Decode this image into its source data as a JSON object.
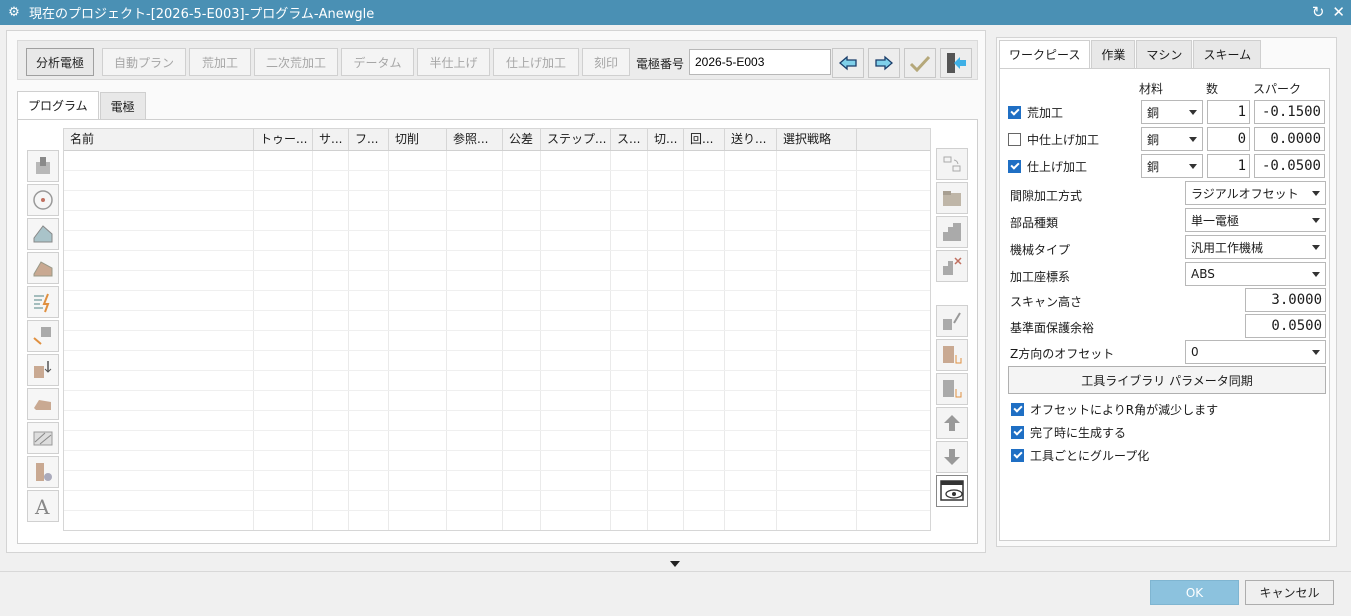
{
  "window": {
    "title": "現在のプロジェクト-[2026-5-E003]-プログラム-Anewgle"
  },
  "toolbar": {
    "buttons": [
      {
        "label": "分析電極",
        "active": true
      },
      {
        "label": "自動プラン",
        "active": false
      },
      {
        "label": "荒加工",
        "active": false
      },
      {
        "label": "二次荒加工",
        "active": false
      },
      {
        "label": "データム",
        "active": false
      },
      {
        "label": "半仕上げ",
        "active": false
      },
      {
        "label": "仕上げ加工",
        "active": false
      },
      {
        "label": "刻印",
        "active": false
      }
    ],
    "electrode_label": "電極番号",
    "electrode_value": "2026-5-E003",
    "icons": [
      "arrow-left-icon",
      "arrow-right-icon",
      "checkmark-icon",
      "exit-icon"
    ]
  },
  "left_tabs": [
    "プログラム",
    "電極"
  ],
  "grid": {
    "columns": [
      "名前",
      "トゥー...",
      "サ...",
      "フ...",
      "切削",
      "参照...",
      "公差",
      "ステップ...",
      "ス...",
      "切...",
      "回...",
      "送り...",
      "選択戦略"
    ],
    "rows": 19
  },
  "side_tools": [
    "cavity-icon",
    "target-icon",
    "surface-icon",
    "block-icon",
    "path-icon",
    "move-icon",
    "split-icon",
    "solid-icon",
    "hatch-icon",
    "tool-icon",
    "text-icon"
  ],
  "right_tools": [
    "sync-icon",
    "folder-icon",
    "stair-icon",
    "delete-icon",
    "edit-icon",
    "pick-icon",
    "pick2-icon",
    "up-icon",
    "down-icon",
    "view-icon"
  ],
  "right_tabs": [
    "ワークピース",
    "作業",
    "マシン",
    "スキーム"
  ],
  "workpiece": {
    "headers": {
      "material": "材料",
      "count": "数",
      "spark": "スパーク"
    },
    "stages": [
      {
        "label": "荒加工",
        "checked": true,
        "material": "銅",
        "count": "1",
        "spark": "-0.1500"
      },
      {
        "label": "中仕上げ加工",
        "checked": false,
        "material": "銅",
        "count": "0",
        "spark": "0.0000"
      },
      {
        "label": "仕上げ加工",
        "checked": true,
        "material": "銅",
        "count": "1",
        "spark": "-0.0500"
      }
    ],
    "params": [
      {
        "label": "間隙加工方式",
        "value": "ラジアルオフセット",
        "type": "select"
      },
      {
        "label": "部品種類",
        "value": "単一電極",
        "type": "select"
      },
      {
        "label": "機械タイプ",
        "value": "汎用工作機械",
        "type": "select"
      },
      {
        "label": "加工座標系",
        "value": "ABS",
        "type": "select"
      },
      {
        "label": "スキャン高さ",
        "value": "3.0000",
        "type": "number"
      },
      {
        "label": "基準面保護余裕",
        "value": "0.0500",
        "type": "number"
      },
      {
        "label": "Z方向のオフセット",
        "value": "0",
        "type": "select"
      }
    ],
    "sync_button": "工具ライブラリ パラメータ同期",
    "options": [
      {
        "label": "オフセットによりR角が減少します",
        "checked": true
      },
      {
        "label": "完了時に生成する",
        "checked": true
      },
      {
        "label": "工具ごとにグループ化",
        "checked": true
      }
    ]
  },
  "footer": {
    "ok": "OK",
    "cancel": "キャンセル"
  },
  "colors": {
    "titlebar": "#4a90b4",
    "accent": "#1f6fc4",
    "ok_button": "#8cc2de"
  }
}
